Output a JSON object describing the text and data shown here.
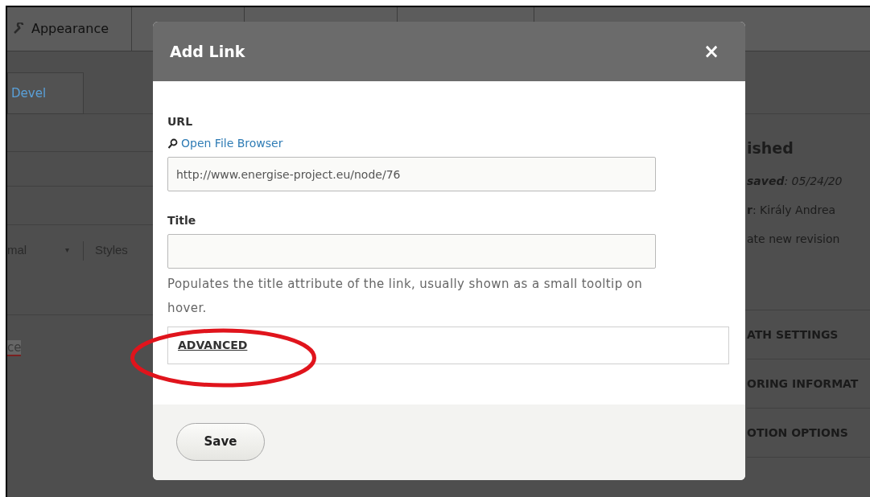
{
  "background": {
    "toolbar": {
      "items": [
        "Appearance"
      ]
    },
    "tab": "Devel",
    "editor_toolbar": {
      "format": "mal",
      "caret": "▾",
      "styles": "Styles"
    },
    "editor_fragment": "ce",
    "publish_panel": {
      "heading": "ished",
      "lines": [
        "**saved**: 05/24/20",
        "**r**: Király Andrea",
        "ate new revision"
      ]
    },
    "sections": [
      "ATH SETTINGS",
      "ORING INFORMAT",
      "OTION OPTIONS"
    ]
  },
  "dialog": {
    "title": "Add Link",
    "close": "×",
    "fields": [
      {
        "label": "URL",
        "link": "Open File Browser",
        "value": "http://www.energise-project.eu/node/76"
      },
      {
        "label": "Title",
        "description": "Populates the title attribute of the link, usually shown as a small tooltip on hover."
      }
    ],
    "advanced": "ADVANCED",
    "buttons": [
      "Save"
    ]
  }
}
